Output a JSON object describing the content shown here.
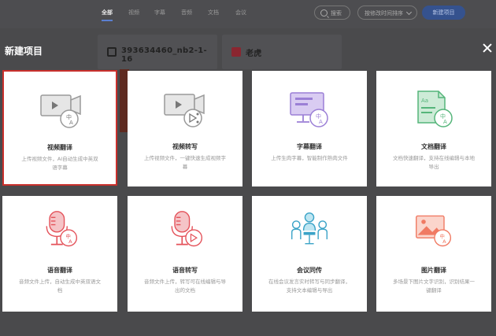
{
  "nav": {
    "tabs": [
      {
        "label": "全部",
        "active": true
      },
      {
        "label": "视频"
      },
      {
        "label": "字幕"
      },
      {
        "label": "音频"
      },
      {
        "label": "文档"
      },
      {
        "label": "会议"
      }
    ],
    "search_label": "搜索",
    "filter_label": "按修改时间排序",
    "new_button_label": "新建项目"
  },
  "background_projects": [
    {
      "name": "393634460_nb2-1-16"
    },
    {
      "name": "老虎"
    }
  ],
  "modal": {
    "title": "新建项目",
    "cards": [
      {
        "title": "视频翻译",
        "desc": "上传视频文件，AI自动生成中英双语字幕",
        "icon": "video-translate-icon",
        "selected": true
      },
      {
        "title": "视频转写",
        "desc": "上传视频文件，一键快速生成视频字幕",
        "icon": "video-transcribe-icon"
      },
      {
        "title": "字幕翻译",
        "desc": "上传生肉字幕，智能制作熟肉文件",
        "icon": "subtitle-translate-icon"
      },
      {
        "title": "文档翻译",
        "desc": "文档快速翻译，支持在线编辑与本地导出",
        "icon": "document-translate-icon"
      },
      {
        "title": "语音翻译",
        "desc": "音频文件上传，自动生成中英双语文档",
        "icon": "audio-translate-icon"
      },
      {
        "title": "语音转写",
        "desc": "音频文件上传，转写可在线编辑与导出的文档",
        "icon": "audio-transcribe-icon"
      },
      {
        "title": "会议同传",
        "desc": "在线会议发言实时转写与同步翻译，支持文本编辑与导出",
        "icon": "meeting-interpret-icon"
      },
      {
        "title": "图片翻译",
        "desc": "多场景下图片文字识别，识别结果一键翻译",
        "icon": "image-translate-icon"
      }
    ]
  },
  "colors": {
    "accent": "#5b7fd1",
    "selected_border": "#c9302c",
    "teal": "#49b5a8",
    "purple": "#9b7fd6",
    "green": "#55b57a",
    "red": "#e4525a",
    "orange": "#f07a63"
  }
}
